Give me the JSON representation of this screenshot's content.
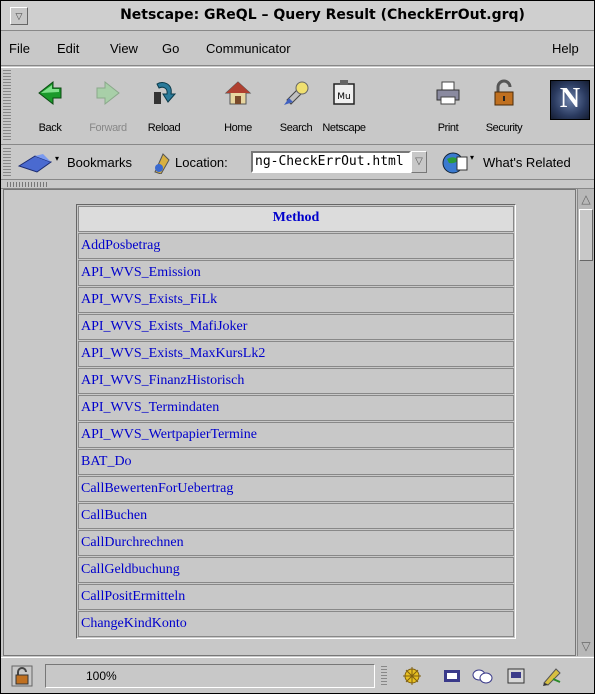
{
  "window": {
    "title": "Netscape: GReQL – Query Result (CheckErrOut.grq)"
  },
  "menubar": {
    "items": [
      "File",
      "Edit",
      "View",
      "Go",
      "Communicator"
    ],
    "help": "Help"
  },
  "toolbar": {
    "back": "Back",
    "forward": "Forward",
    "reload": "Reload",
    "home": "Home",
    "search": "Search",
    "netscape": "Netscape",
    "print": "Print",
    "security": "Security",
    "logo": "N"
  },
  "location": {
    "bookmarks": "Bookmarks",
    "label": "Location:",
    "value": "ng-CheckErrOut.html",
    "related": "What's Related"
  },
  "table": {
    "header": "Method",
    "rows": [
      "AddPosbetrag",
      "API_WVS_Emission",
      "API_WVS_Exists_FiLk",
      "API_WVS_Exists_MafiJoker",
      "API_WVS_Exists_MaxKursLk2",
      "API_WVS_FinanzHistorisch",
      "API_WVS_Termindaten",
      "API_WVS_WertpapierTermine",
      "BAT_Do",
      "CallBewertenForUebertrag",
      "CallBuchen",
      "CallDurchrechnen",
      "CallGeldbuchung",
      "CallPositErmitteln",
      "ChangeKindKonto"
    ]
  },
  "status": {
    "zoom": "100%"
  },
  "colors": {
    "link": "#0000cc",
    "chrome": "#c8c8c8"
  }
}
